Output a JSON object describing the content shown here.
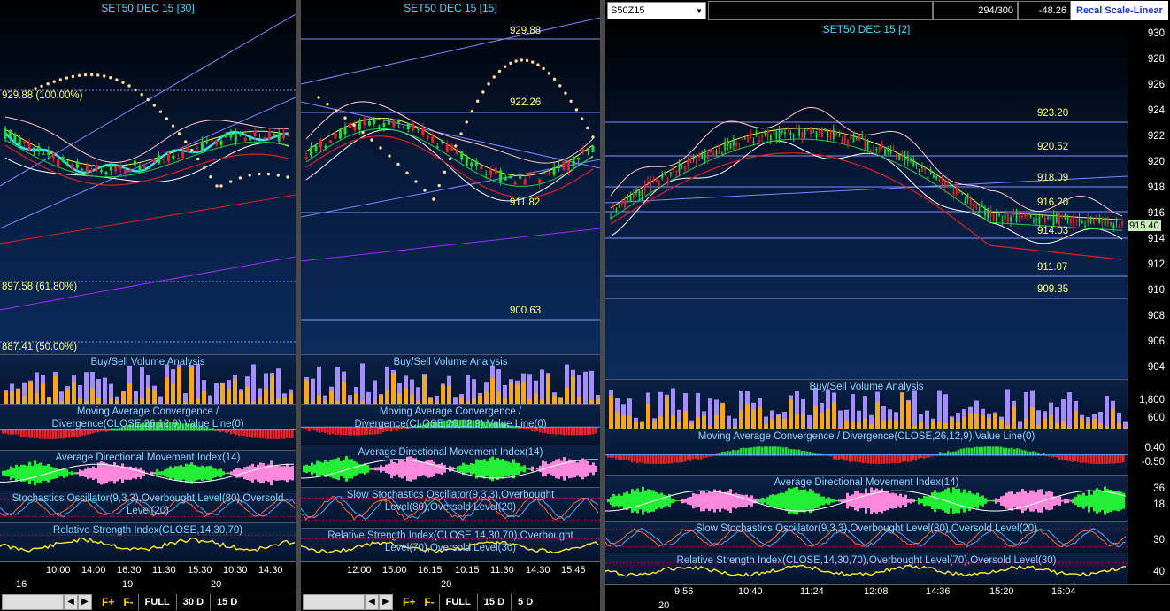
{
  "panes": [
    {
      "title": "SET50 DEC 15  [30]",
      "fib_labels": [
        "929.88 (100.00%)",
        "897.58 (61.80%)",
        "887.41 (50.00%)"
      ],
      "panels": [
        "Buy/Sell Volume Analysis",
        "Moving Average Convergence / Divergence(CLOSE,26,12,9),Value Line(0)",
        "Average Directional Movement Index(14)",
        "Stochastics Oscillator(9,3,3),Overbought Level(80),Oversold Level(20)",
        "Relative Strength Index(CLOSE,14,30,70)"
      ],
      "times": [
        "10:00",
        "14:00",
        "16:30",
        "11:30",
        "15:30",
        "10:30",
        "14:30"
      ],
      "dates": [
        "16",
        "19",
        "20"
      ],
      "toolbar": {
        "f_plus": "F+",
        "f_minus": "F-",
        "full": "FULL",
        "range1": "30 D",
        "range2": "15 D"
      }
    },
    {
      "title": "SET50 DEC 15  [15]",
      "price_labels": [
        "929.88",
        "922.26",
        "911.82",
        "900.63"
      ],
      "panels": [
        "Buy/Sell Volume Analysis",
        "Moving Average Convergence / Divergence(CLOSE,26,12,9),Value Line(0)",
        "Average Directional Movement Index(14)",
        "Slow Stochastics Oscillator(9,3,3),Overbought Level(80),Oversold Level(20)",
        "Relative Strength Index(CLOSE,14,30,70),Overbought Level(70),Oversold Level(30)"
      ],
      "times": [
        "12:00",
        "15:00",
        "16:15",
        "10:15",
        "11:30",
        "14:30",
        "15:45"
      ],
      "dates": [
        "20"
      ],
      "toolbar": {
        "f_plus": "F+",
        "f_minus": "F-",
        "full": "FULL",
        "range1": "15 D",
        "range2": "5 D"
      }
    },
    {
      "title": "SET50 DEC 15  [2]",
      "header": {
        "symbol": "S50Z15",
        "count": "294/300",
        "change": "-48.26",
        "recal": "Recal Scale-Linear"
      },
      "price_labels": [
        "923.20",
        "920.52",
        "918.09",
        "916.20",
        "914.03",
        "911.07",
        "909.35"
      ],
      "last_price": "915.40",
      "yticks": [
        "930",
        "928",
        "926",
        "924",
        "922",
        "920",
        "918",
        "916",
        "914",
        "912",
        "910",
        "908",
        "906",
        "904"
      ],
      "vol_ticks": [
        "1,800",
        "600"
      ],
      "macd_ticks": [
        "0.40",
        "-0.50"
      ],
      "adx_ticks": [
        "36",
        "18"
      ],
      "sto_ticks": [
        "30"
      ],
      "rsi_ticks": [
        "40"
      ],
      "panels": [
        "Buy/Sell Volume Analysis",
        "Moving Average Convergence / Divergence(CLOSE,26,12,9),Value Line(0)",
        "Average Directional Movement Index(14)",
        "Slow Stochastics Oscillator(9,3,3),Overbought Level(80),Oversold Level(20)",
        "Relative Strength Index(CLOSE,14,30,70),Overbought Level(70),Oversold Level(30)"
      ],
      "times": [
        "9:56",
        "10:40",
        "11:24",
        "12:08",
        "14:36",
        "15:20",
        "16:04"
      ],
      "dates": [
        "20"
      ]
    }
  ],
  "colors": {
    "bull": "#22dd33",
    "bear": "#ee2222",
    "vol_buy": "#f5a623",
    "vol_sell": "#a58cff",
    "cyan": "#33e6ff",
    "label": "#ffff66"
  }
}
